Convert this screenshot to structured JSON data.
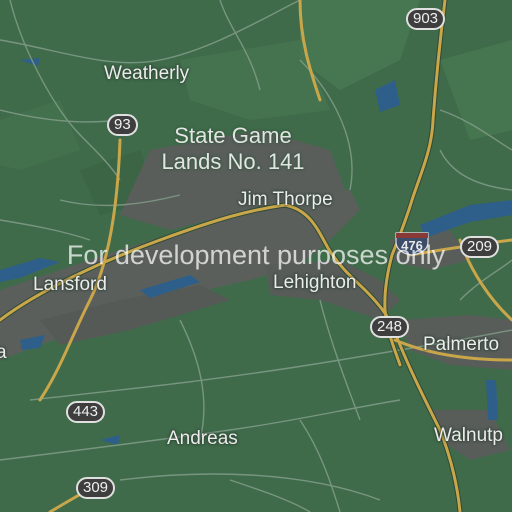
{
  "places": {
    "weatherly": "Weatherly",
    "jim_thorpe": "Jim Thorpe",
    "lansford": "Lansford",
    "lehighton": "Lehighton",
    "palmerton": "Palmerto",
    "andreas": "Andreas",
    "walnutport": "Walnutp",
    "left_edge": "a"
  },
  "area": {
    "line1": "State Game",
    "line2": "Lands No. 141"
  },
  "routes": {
    "r903": "903",
    "r93": "93",
    "r209": "209",
    "r248": "248",
    "r443": "443",
    "r309": "309",
    "i476": "476"
  },
  "watermark": "For development purposes only",
  "colors": {
    "land": "#3f6b4a",
    "urban": "#5a5f5c",
    "water": "#2d5f8a",
    "road_major": "#c9a64a",
    "road_minor": "#7f9a86"
  }
}
